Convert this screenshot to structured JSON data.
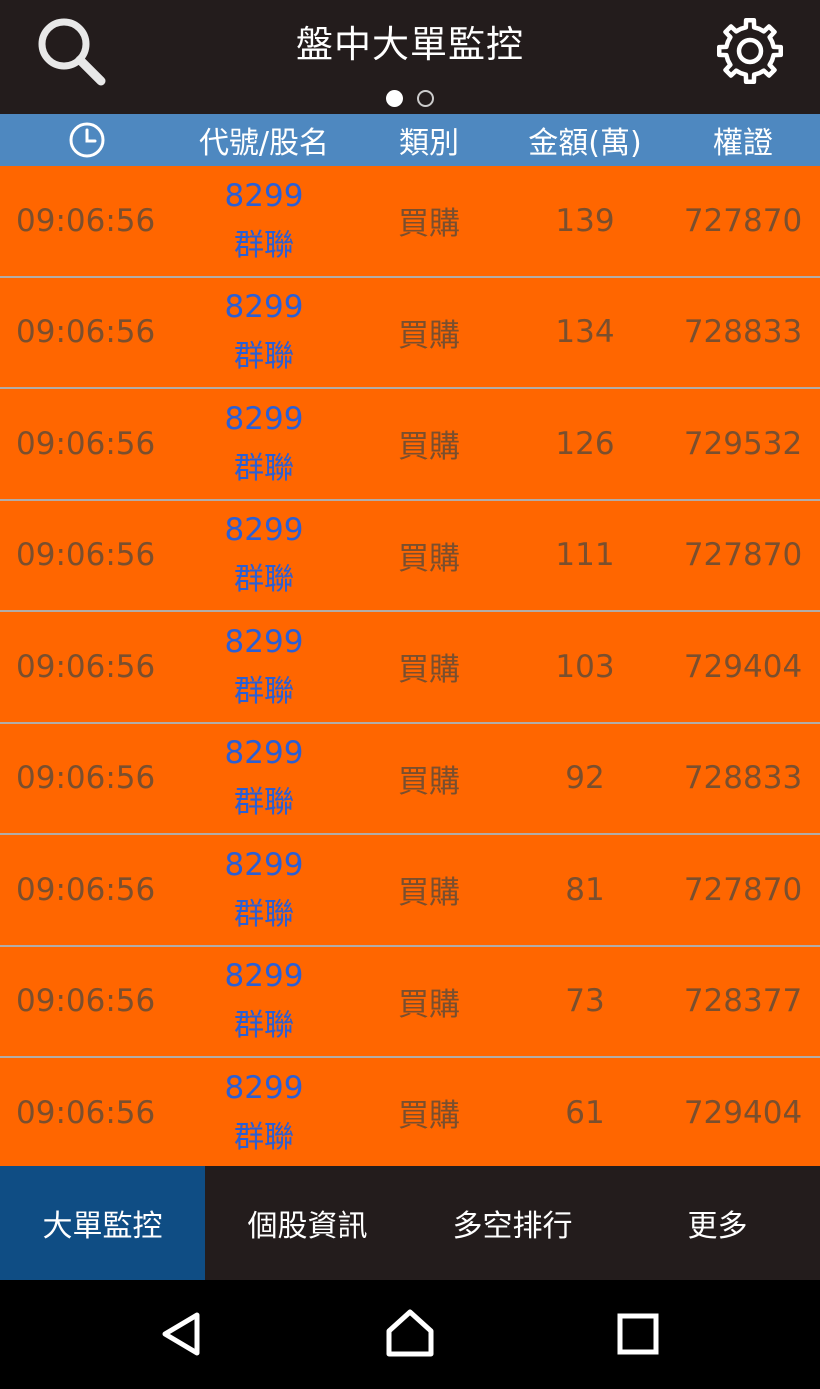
{
  "header": {
    "title": "盤中大單監控",
    "search_icon": "search-icon",
    "settings_icon": "gear-icon",
    "pages": 2,
    "active_page": 1
  },
  "columns": {
    "time_icon": "clock-icon",
    "code_name": "代號/股名",
    "type": "類別",
    "amount": "金額(萬)",
    "warrant": "權證"
  },
  "rows": [
    {
      "time": "09:06:56",
      "code": "8299",
      "name": "群聯",
      "type": "買購",
      "amount": "139",
      "warrant": "727870"
    },
    {
      "time": "09:06:56",
      "code": "8299",
      "name": "群聯",
      "type": "買購",
      "amount": "134",
      "warrant": "728833"
    },
    {
      "time": "09:06:56",
      "code": "8299",
      "name": "群聯",
      "type": "買購",
      "amount": "126",
      "warrant": "729532"
    },
    {
      "time": "09:06:56",
      "code": "8299",
      "name": "群聯",
      "type": "買購",
      "amount": "111",
      "warrant": "727870"
    },
    {
      "time": "09:06:56",
      "code": "8299",
      "name": "群聯",
      "type": "買購",
      "amount": "103",
      "warrant": "729404"
    },
    {
      "time": "09:06:56",
      "code": "8299",
      "name": "群聯",
      "type": "買購",
      "amount": "92",
      "warrant": "728833"
    },
    {
      "time": "09:06:56",
      "code": "8299",
      "name": "群聯",
      "type": "買購",
      "amount": "81",
      "warrant": "727870"
    },
    {
      "time": "09:06:56",
      "code": "8299",
      "name": "群聯",
      "type": "買購",
      "amount": "73",
      "warrant": "728377"
    },
    {
      "time": "09:06:56",
      "code": "8299",
      "name": "群聯",
      "type": "買購",
      "amount": "61",
      "warrant": "729404"
    }
  ],
  "tabs": [
    {
      "label": "大單監控",
      "active": true
    },
    {
      "label": "個股資訊",
      "active": false
    },
    {
      "label": "多空排行",
      "active": false
    },
    {
      "label": "更多",
      "active": false
    }
  ],
  "system_nav": {
    "back_icon": "back-triangle-icon",
    "home_icon": "home-icon",
    "recents_icon": "recents-square-icon"
  },
  "colors": {
    "topbar_bg": "#231c1c",
    "header_row_bg": "#4e88c0",
    "row_bg": "#ff6600",
    "code_text": "#2b5fd4",
    "row_text": "#7a4f2e",
    "active_tab_bg": "#0f4d84"
  }
}
